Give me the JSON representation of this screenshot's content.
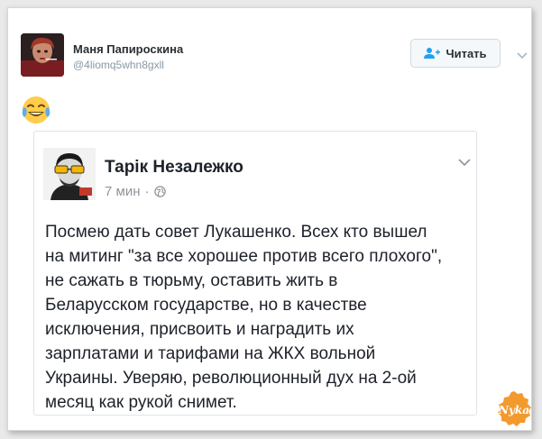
{
  "tweet": {
    "author_name": "Маня Папироскина",
    "author_handle": "@4liomq5whn8gxll",
    "follow_label": "Читать",
    "emoji": "tears-of-joy"
  },
  "quoted_post": {
    "author_name": "Тарік Незалежко",
    "time": "7 мин",
    "separator": "·",
    "text": "Посмею дать совет Лукашенко. Всех кто вышел\nна митинг \"за все хорошее против всего плохого\",\nне сажать в тюрьму, оставить жить в\nБеларусском государстве, но в качестве\nисключения, присвоить и наградить их\nзарплатами и тарифами на ЖКХ вольной\nУкраины. Уверяю, революционный дух на 2-ой\nмесяц как рукой снимет."
  },
  "watermark": {
    "text": "Nyka"
  },
  "colors": {
    "accent_blue": "#1da1f2",
    "watermark_orange": "#f29a2e"
  }
}
